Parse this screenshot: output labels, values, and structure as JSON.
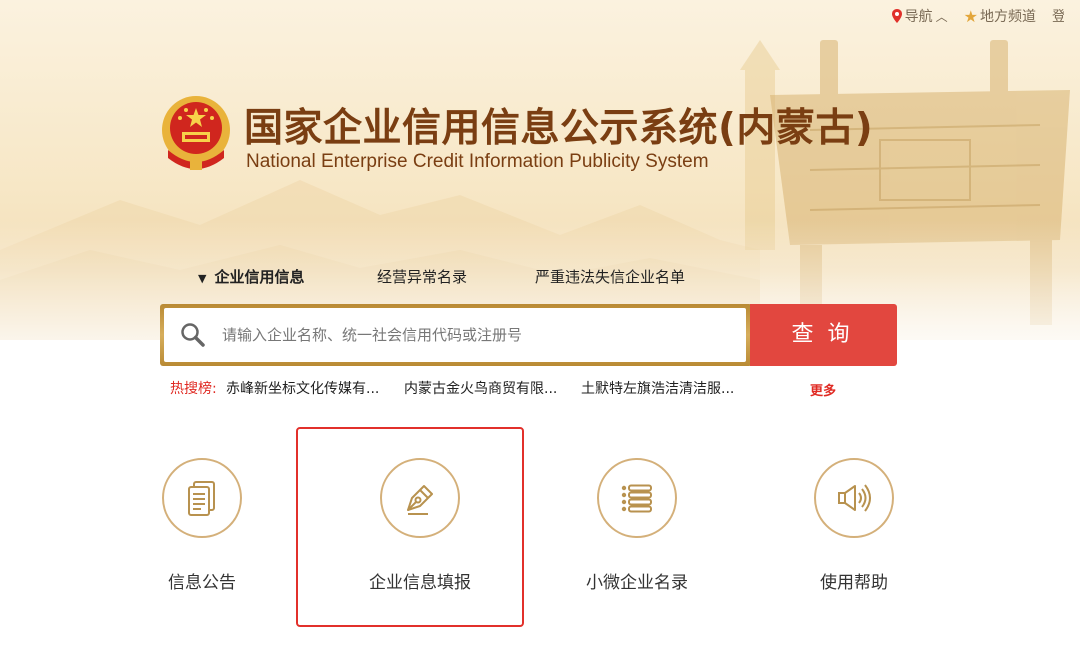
{
  "topbar": {
    "nav_label": "导航",
    "nav_chevron": "︿",
    "local_label": "地方频道",
    "login_partial": "登"
  },
  "logo": {
    "title_cn": "国家企业信用信息公示系统(内蒙古)",
    "title_en": "National Enterprise Credit Information Publicity System"
  },
  "tabs": [
    {
      "label": "企业信用信息",
      "active": true
    },
    {
      "label": "经营异常名录",
      "active": false
    },
    {
      "label": "严重违法失信企业名单",
      "active": false
    }
  ],
  "search": {
    "placeholder": "请输入企业名称、统一社会信用代码或注册号",
    "button_label": "查询"
  },
  "hot_search": {
    "label": "热搜榜:",
    "keywords": [
      "赤峰新坐标文化传媒有...",
      "内蒙古金火鸟商贸有限...",
      "土默特左旗浩洁清洁服..."
    ],
    "more_label": "更多"
  },
  "features": [
    {
      "label": "信息公告",
      "icon": "document-icon"
    },
    {
      "label": "企业信息填报",
      "icon": "pen-icon",
      "highlighted": true
    },
    {
      "label": "小微企业名录",
      "icon": "list-icon"
    },
    {
      "label": "使用帮助",
      "icon": "speaker-icon"
    }
  ],
  "colors": {
    "accent_red": "#e2473f",
    "gold": "#d4b07a",
    "title_brown": "#7a3e12",
    "highlight_red": "#e2302b"
  }
}
